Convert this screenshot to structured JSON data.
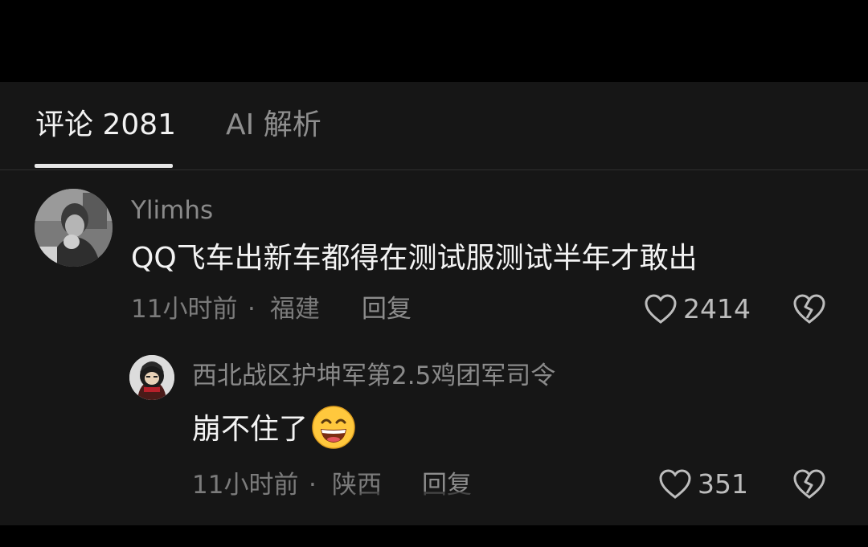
{
  "tabs": {
    "comments_label": "评论 2081",
    "ai_label": "AI 解析"
  },
  "comment": {
    "username": "Ylimhs",
    "text": "QQ飞车出新车都得在测试服测试半年才敢出",
    "time": "11小时前",
    "separator": "·",
    "location": "福建",
    "reply_label": "回复",
    "like_count": "2414",
    "like_icon": "heart-outline-icon",
    "dislike_icon": "broken-heart-icon"
  },
  "reply": {
    "username": "西北战区护坤军第2.5鸡团军司令",
    "text": "崩不住了",
    "emoji": "grinning-face-emoji",
    "time": "11小时前",
    "separator": "·",
    "location": "陕西",
    "reply_label": "回复",
    "like_count": "351",
    "like_icon": "heart-outline-icon",
    "dislike_icon": "broken-heart-icon"
  },
  "colors": {
    "background": "#000000",
    "panel": "#161616",
    "primary_text": "#f3f3f3",
    "secondary_text": "#8a8a8a",
    "tab_indicator": "#e6e6e6",
    "emoji_yellow": "#ffc83d"
  }
}
